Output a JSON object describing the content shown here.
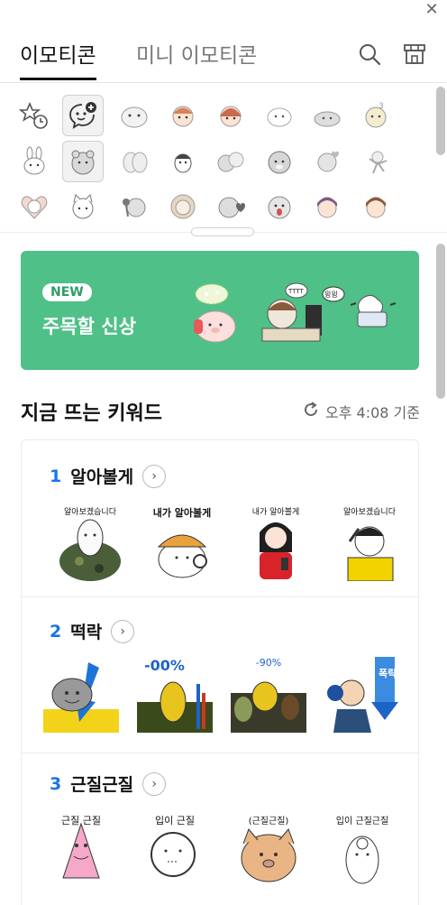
{
  "window": {
    "close_glyph": "✕"
  },
  "tabs": [
    {
      "label": "이모티콘",
      "active": true
    },
    {
      "label": "미니 이모티콘",
      "active": false
    }
  ],
  "header_icons": [
    "search-icon",
    "store-icon"
  ],
  "picker": {
    "rows": [
      [
        "recent-star-icon",
        "add-emoticon-icon",
        "white-seal",
        "red-hair-kid",
        "red-hair-girl",
        "white-blob",
        "gray-hamster",
        "gold-number3-blob"
      ],
      [
        "white-rabbit",
        "gray-bear-selected",
        "gray-ghosts",
        "dark-penguin",
        "gray-duo",
        "gray-bear",
        "gray-hearts",
        "gray-dancer"
      ],
      [
        "heart-kid",
        "white-cat",
        "rose-bear",
        "beige-lion",
        "gray-bear-heart",
        "gray-seal",
        "purple-hair-boy",
        "orange-hair-boy"
      ]
    ]
  },
  "banner": {
    "badge": "NEW",
    "title": "주목할 신상",
    "bg_color": "#4fc088",
    "bubble_texts": [
      "TTTT",
      "읭읭"
    ]
  },
  "keywords": {
    "title": "지금 뜨는 키워드",
    "time_label": "오후 4:08 기준",
    "items": [
      {
        "num": "1",
        "label": "알아볼게",
        "stickers": [
          {
            "caption": "알아보겠습니다",
            "name": "soldier-seal"
          },
          {
            "caption": "내가 알아볼게",
            "name": "detective-blob"
          },
          {
            "caption": "내가 알아볼게",
            "name": "red-girl-phone"
          },
          {
            "caption": "알아보겠습니다",
            "name": "saluting-officer"
          }
        ]
      },
      {
        "num": "2",
        "label": "떡락",
        "stickers": [
          {
            "caption": "",
            "name": "gray-blob-down-arrow"
          },
          {
            "caption": "-00%",
            "name": "yellow-bird-chart"
          },
          {
            "caption": "-90%",
            "name": "dropping-birds"
          },
          {
            "caption": "폭락",
            "name": "boxer-crash"
          }
        ]
      },
      {
        "num": "3",
        "label": "근질근질",
        "stickers": [
          {
            "caption": "근질 근질",
            "name": "pink-patrick"
          },
          {
            "caption": "입이 근질",
            "name": "white-ghost"
          },
          {
            "caption": "(근질근질)",
            "name": "brown-dog"
          },
          {
            "caption": "입이 근질근질",
            "name": "egg-character"
          }
        ]
      }
    ]
  }
}
